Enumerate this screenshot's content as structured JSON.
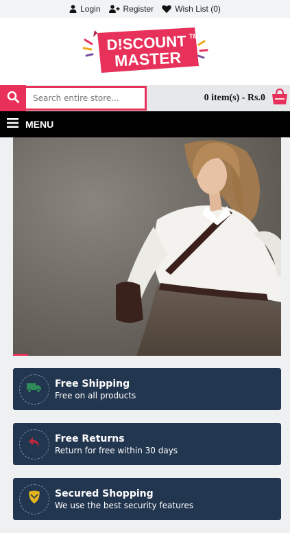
{
  "toplinks": {
    "login": "Login",
    "register": "Register",
    "wishlist": "Wish List (0)"
  },
  "logo": {
    "line1": "D!SCOUNT",
    "line2": "MASTER",
    "tm": "TM"
  },
  "search": {
    "placeholder": "Search entire store..."
  },
  "cart": {
    "summary": "0 item(s) - Rs.0"
  },
  "menu": {
    "label": "MENU"
  },
  "features": [
    {
      "title": "Free Shipping",
      "subtitle": "Free on all products",
      "icon": "truck-icon"
    },
    {
      "title": "Free Returns",
      "subtitle": "Return for free within 30 days",
      "icon": "return-arrow-icon"
    },
    {
      "title": "Secured Shopping",
      "subtitle": "We use the best security features",
      "icon": "shield-icon"
    }
  ],
  "colors": {
    "accent": "#e8315a",
    "feature_bg": "#233650",
    "menu_bg": "#000000"
  }
}
